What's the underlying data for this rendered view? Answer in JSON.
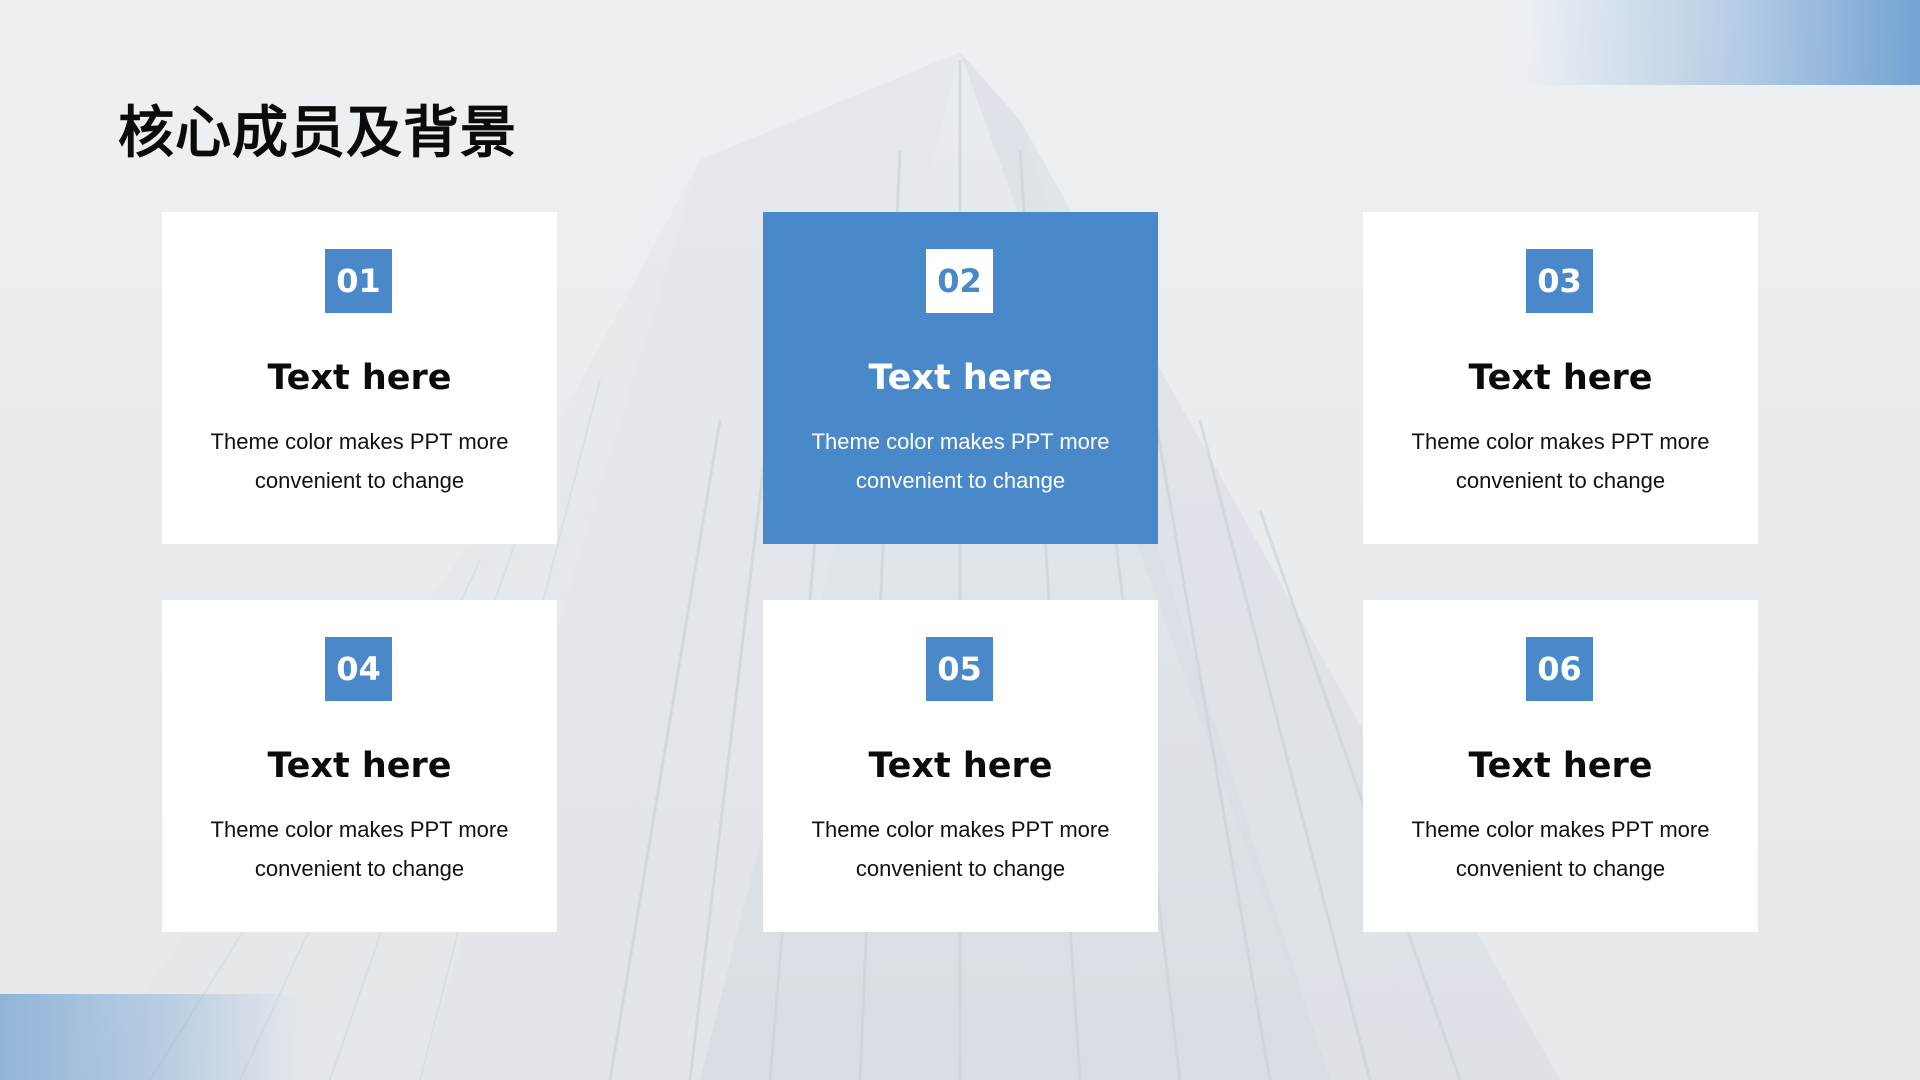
{
  "slide": {
    "title": "核心成员及背景"
  },
  "colors": {
    "accent": "#4a89c9",
    "background": "#e9ecef",
    "card": "#ffffff",
    "title_text": "#0b0b0b"
  },
  "cards": [
    {
      "number": "01",
      "heading": "Text here",
      "desc_line1": "Theme  color makes  PPT more",
      "desc_line2": "convenient  to change",
      "highlighted": false
    },
    {
      "number": "02",
      "heading": "Text here",
      "desc_line1": "Theme  color makes  PPT more",
      "desc_line2": "convenient  to change",
      "highlighted": true
    },
    {
      "number": "03",
      "heading": "Text here",
      "desc_line1": "Theme  color makes  PPT more",
      "desc_line2": "convenient  to change",
      "highlighted": false
    },
    {
      "number": "04",
      "heading": "Text here",
      "desc_line1": "Theme  color makes  PPT more",
      "desc_line2": "convenient  to change",
      "highlighted": false
    },
    {
      "number": "05",
      "heading": "Text here",
      "desc_line1": "Theme  color makes  PPT more",
      "desc_line2": "convenient  to change",
      "highlighted": false
    },
    {
      "number": "06",
      "heading": "Text here",
      "desc_line1": "Theme  color makes  PPT more",
      "desc_line2": "convenient  to change",
      "highlighted": false
    }
  ]
}
